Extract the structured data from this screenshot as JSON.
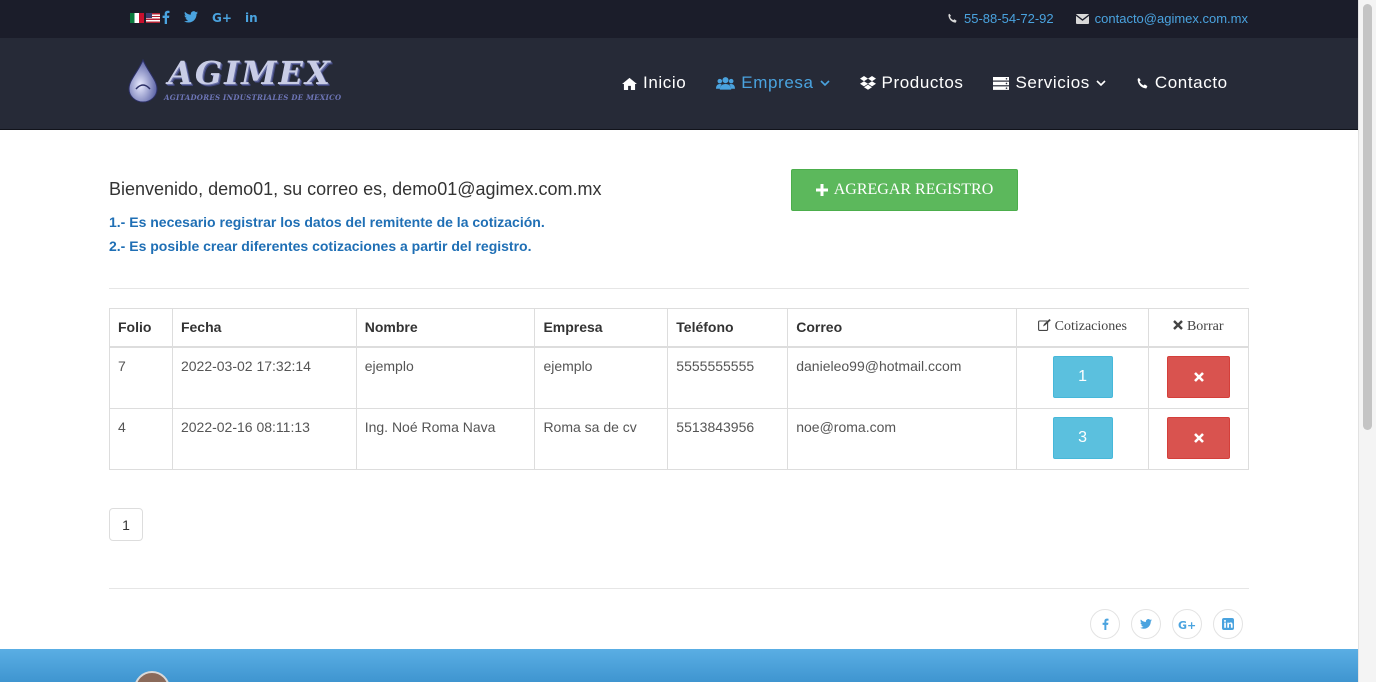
{
  "topbar": {
    "phone": "55-88-54-72-92",
    "email": "contacto@agimex.com.mx",
    "social_icons": [
      "facebook-icon",
      "twitter-icon",
      "google-plus-icon",
      "linkedin-icon"
    ]
  },
  "brand": {
    "name": "AGIMEX",
    "tagline": "AGITADORES INDUSTRIALES DE MEXICO"
  },
  "nav": {
    "items": [
      {
        "label": "Inicio",
        "icon": "home-icon"
      },
      {
        "label": "Empresa",
        "icon": "users-icon",
        "active": true
      },
      {
        "label": "Productos",
        "icon": "dropbox-icon"
      },
      {
        "label": "Servicios",
        "icon": "server-icon"
      },
      {
        "label": "Contacto",
        "icon": "phone-icon"
      }
    ]
  },
  "main": {
    "welcome": "Bienvenido, demo01, su correo es, demo01@agimex.com.mx",
    "note1": "1.- Es necesario registrar los datos del remitente de la cotización.",
    "note2": "2.- Es posible crear diferentes cotizaciones a partir del registro.",
    "add_button": "AGREGAR REGISTRO"
  },
  "table": {
    "headers": [
      "Folio",
      "Fecha",
      "Nombre",
      "Empresa",
      "Teléfono",
      "Correo",
      "Cotizaciones",
      "Borrar"
    ],
    "rows": [
      {
        "folio": "7",
        "fecha": "2022-03-02 17:32:14",
        "nombre": "ejemplo",
        "empresa": "ejemplo",
        "telefono": "5555555555",
        "correo": "danieleo99@hotmail.ccom",
        "cotizaciones": "1"
      },
      {
        "folio": "4",
        "fecha": "2022-02-16 08:11:13",
        "nombre": "Ing. Noé Roma Nava",
        "empresa": "Roma sa de cv",
        "telefono": "5513843956",
        "correo": "noe@roma.com",
        "cotizaciones": "3"
      }
    ]
  },
  "pagination": {
    "current": "1"
  },
  "colors": {
    "accent": "#4aa3df",
    "success": "#5cb85c",
    "info": "#5bc0de",
    "danger": "#d9534f",
    "note": "#1f6fb5"
  }
}
